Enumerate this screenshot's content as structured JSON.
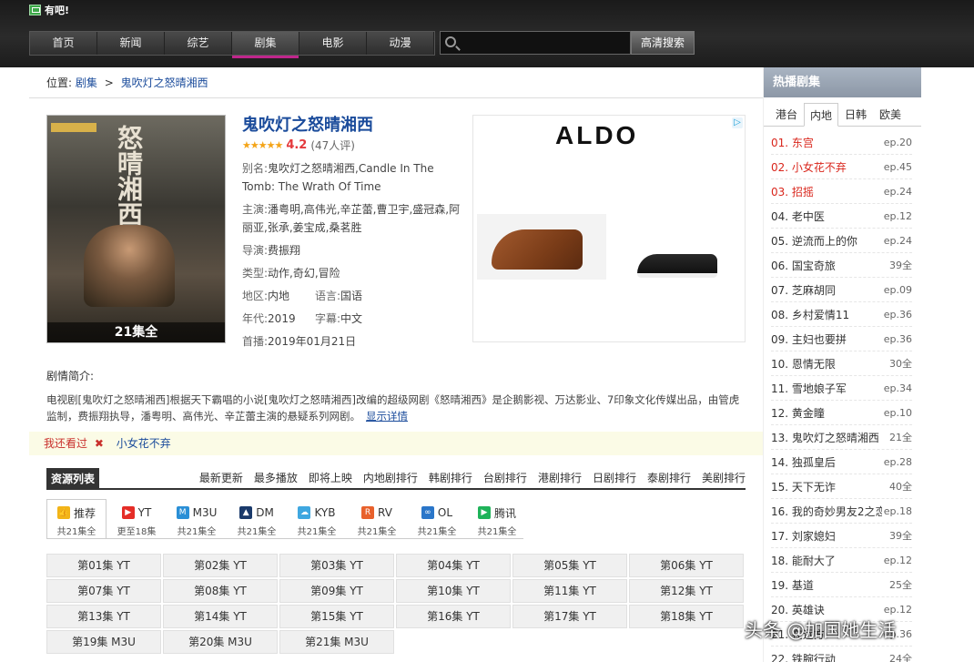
{
  "app": {
    "logo_text": "有吧!"
  },
  "nav": {
    "items": [
      "首页",
      "新闻",
      "综艺",
      "剧集",
      "电影",
      "动漫"
    ],
    "active_index": 3
  },
  "search": {
    "placeholder": "",
    "button_label": "高清搜索"
  },
  "breadcrumb": {
    "prefix": "位置:",
    "level1": "剧集",
    "separator": ">",
    "current": "鬼吹灯之怒晴湘西"
  },
  "poster": {
    "title_art": "怒晴湘西",
    "caption": "21集全"
  },
  "show": {
    "title": "鬼吹灯之怒晴湘西",
    "stars": "★★★★★",
    "score": "4.2",
    "votes": "(47人评)",
    "alias_label": "别名:",
    "alias": "鬼吹灯之怒晴湘西,Candle In The Tomb: The Wrath Of Time",
    "cast_label": "主演:",
    "cast": "潘粤明,高伟光,辛芷蕾,曹卫宇,盛冠森,阿丽亚,张承,姜宝成,桑茗胜",
    "director_label": "导演:",
    "director": "费振翔",
    "genre_label": "类型:",
    "genre": "动作,奇幻,冒险",
    "region_label": "地区:",
    "region": "内地",
    "language_label": "语言:",
    "language": "国语",
    "year_label": "年代:",
    "year": "2019",
    "subtitle_label": "字幕:",
    "subtitle": "中文",
    "premiere_label": "首播:",
    "premiere": "2019年01月21日"
  },
  "ad": {
    "brand": "ALDO",
    "choice_icon": "▷"
  },
  "synopsis": {
    "title": "剧情简介:",
    "text": "电视剧[鬼吹灯之怒晴湘西]根据天下霸唱的小说[鬼吹灯之怒晴湘西]改编的超级网剧《怒晴湘西》是企鹅影视、万达影业、7印象文化传媒出品，由管虎监制，费振翔执导，潘粤明、高伟光、辛芷蕾主演的悬疑系列网剧。",
    "more_link": "显示详情"
  },
  "history": {
    "label": "我还看过",
    "close_glyph": "✖",
    "link": "小女花不弃"
  },
  "resources": {
    "title": "资源列表",
    "links": [
      "最新更新",
      "最多播放",
      "即将上映",
      "内地剧排行",
      "韩剧排行",
      "台剧排行",
      "港剧排行",
      "日剧排行",
      "泰剧排行",
      "美剧排行"
    ]
  },
  "sources": [
    {
      "icon": "thumbs-up-icon",
      "name": "推荐",
      "count": "共21集全",
      "color": "#f2b418",
      "glyph": "👍"
    },
    {
      "icon": "youtube-icon",
      "name": "YT",
      "count": "更至18集",
      "color": "#e52d27",
      "glyph": "▶"
    },
    {
      "icon": "m3u-icon",
      "name": "M3U",
      "count": "共21集全",
      "color": "#2a8fd6",
      "glyph": "M"
    },
    {
      "icon": "dm-icon",
      "name": "DM",
      "count": "共21集全",
      "color": "#1a3a6b",
      "glyph": "▲"
    },
    {
      "icon": "kyb-icon",
      "name": "KYB",
      "count": "共21集全",
      "color": "#3fa7e0",
      "glyph": "☁"
    },
    {
      "icon": "rv-icon",
      "name": "RV",
      "count": "共21集全",
      "color": "#e8612c",
      "glyph": "R"
    },
    {
      "icon": "ol-icon",
      "name": "OL",
      "count": "共21集全",
      "color": "#2a76c9",
      "glyph": "∞"
    },
    {
      "icon": "tencent-video-icon",
      "name": "腾讯",
      "count": "共21集全",
      "color": "#1fb35a",
      "glyph": "▶"
    }
  ],
  "episodes": [
    "第01集 YT",
    "第02集 YT",
    "第03集 YT",
    "第04集 YT",
    "第05集 YT",
    "第06集 YT",
    "第07集 YT",
    "第08集 YT",
    "第09集 YT",
    "第10集 YT",
    "第11集 YT",
    "第12集 YT",
    "第13集 YT",
    "第14集 YT",
    "第15集 YT",
    "第16集 YT",
    "第17集 YT",
    "第18集 YT",
    "第19集 M3U",
    "第20集 M3U",
    "第21集 M3U"
  ],
  "sidebar": {
    "title": "热播剧集",
    "tabs": [
      "港台",
      "内地",
      "日韩",
      "欧美"
    ],
    "active_tab": 1,
    "items": [
      {
        "name": "01. 东宫",
        "ep": "ep.20",
        "hot": true
      },
      {
        "name": "02. 小女花不弃",
        "ep": "ep.45",
        "hot": true
      },
      {
        "name": "03. 招摇",
        "ep": "ep.24",
        "hot": true
      },
      {
        "name": "04. 老中医",
        "ep": "ep.12",
        "hot": false
      },
      {
        "name": "05. 逆流而上的你",
        "ep": "ep.24",
        "hot": false
      },
      {
        "name": "06. 国宝奇旅",
        "ep": "39全",
        "hot": false
      },
      {
        "name": "07. 芝麻胡同",
        "ep": "ep.09",
        "hot": false
      },
      {
        "name": "08. 乡村爱情11",
        "ep": "ep.36",
        "hot": false
      },
      {
        "name": "09. 主妇也要拼",
        "ep": "ep.36",
        "hot": false
      },
      {
        "name": "10. 恩情无限",
        "ep": "30全",
        "hot": false
      },
      {
        "name": "11. 雪地娘子军",
        "ep": "ep.34",
        "hot": false
      },
      {
        "name": "12. 黄金瞳",
        "ep": "ep.10",
        "hot": false
      },
      {
        "name": "13. 鬼吹灯之怒晴湘西",
        "ep": "21全",
        "hot": false
      },
      {
        "name": "14. 独孤皇后",
        "ep": "ep.28",
        "hot": false
      },
      {
        "name": "15. 天下无诈",
        "ep": "40全",
        "hot": false
      },
      {
        "name": "16. 我的奇妙男友2之恋",
        "ep": "ep.18",
        "hot": false
      },
      {
        "name": "17. 刘家媳妇",
        "ep": "39全",
        "hot": false
      },
      {
        "name": "18. 能耐大了",
        "ep": "ep.12",
        "hot": false
      },
      {
        "name": "19. 基道",
        "ep": "25全",
        "hot": false
      },
      {
        "name": "20. 英雄诀",
        "ep": "ep.12",
        "hot": false
      },
      {
        "name": "21. 在远方",
        "ep": "ep.36",
        "hot": false
      },
      {
        "name": "22. 铁腕行动",
        "ep": "24全",
        "hot": false
      }
    ]
  },
  "watermark": "头条 @加国她生活"
}
